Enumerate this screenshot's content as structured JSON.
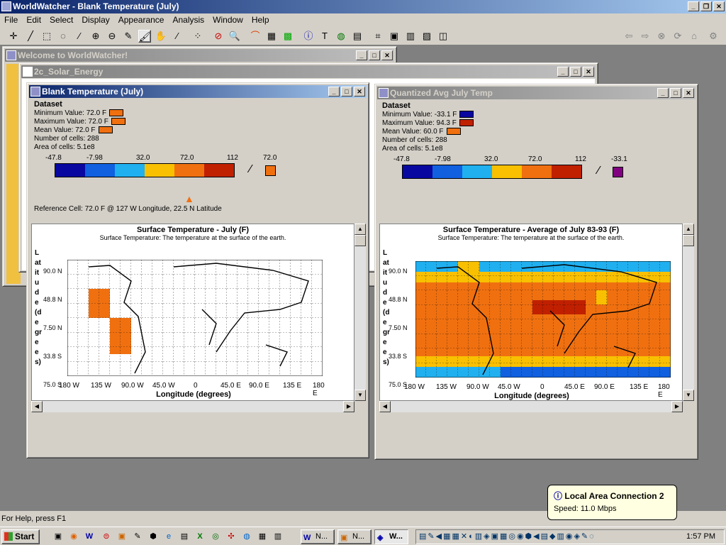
{
  "app": {
    "title": "WorldWatcher - Blank Temperature (July)"
  },
  "menu": [
    "File",
    "Edit",
    "Select",
    "Display",
    "Appearance",
    "Analysis",
    "Window",
    "Help"
  ],
  "icons": {
    "toolbar": [
      "crosshair-icon",
      "line-icon",
      "rect-select-icon",
      "lasso-icon",
      "wand-icon",
      "zoom-in-icon",
      "zoom-out-icon",
      "pencil-icon",
      "brush-icon",
      "hand-icon",
      "eyedropper-icon",
      "footprints-icon",
      "no-pan-icon",
      "magnifier-icon",
      "rainbow-icon",
      "grid-icon",
      "color-grid-icon",
      "info-icon",
      "text-icon",
      "globe-icon",
      "map-icon",
      "crop-icon",
      "image-icon",
      "histogram-icon",
      "graph-icon"
    ],
    "nav": [
      "back-icon",
      "forward-icon",
      "stop-icon",
      "refresh-icon",
      "home-icon",
      "gear-icon"
    ]
  },
  "windows": {
    "welcome": {
      "title": "Welcome to WorldWatcher!"
    },
    "solar": {
      "title": "2c_Solar_Energy"
    },
    "blank": {
      "title": "Blank Temperature (July)",
      "heading": "Dataset",
      "min": "Minimum Value: 72.0 F",
      "max": "Maximum Value: 72.0 F",
      "mean": "Mean Value: 72.0 F",
      "cells": "Number of cells: 288",
      "area": "Area of cells: 5.1e8",
      "ticks": [
        "-47.8",
        "-7.98",
        "32.0",
        "72.0",
        "112"
      ],
      "current": "72.0",
      "current_color": "#f07010",
      "ref": "Reference Cell: 72.0 F @ 127 W Longitude, 22.5 N Latitude",
      "plot_title": "Surface Temperature - July (F)",
      "plot_subtitle": "Surface Temperature: The temperature at the surface of the earth.",
      "ylabel": "Latitude (degrees)",
      "xlabel": "Longitude (degrees)",
      "yticks": [
        "90.0 N",
        "48.8 N",
        "7.50 N",
        "33.8 S",
        "75.0 S"
      ],
      "xticks": [
        "180 W",
        "135 W",
        "90.0 W",
        "45.0 W",
        "0",
        "45.0 E",
        "90.0 E",
        "135 E",
        "180 E"
      ]
    },
    "quant": {
      "title": "Quantized Avg July Temp",
      "heading": "Dataset",
      "min": "Minimum Value: -33.1 F",
      "max": "Maximum Value: 94.3 F",
      "mean": "Mean Value: 60.0 F",
      "cells": "Number of cells: 288",
      "area": "Area of cells: 5.1e8",
      "ticks": [
        "-47.8",
        "-7.98",
        "32.0",
        "72.0",
        "112"
      ],
      "current": "-33.1",
      "current_color": "#800080",
      "plot_title": "Surface Temperature - Average of July 83-93 (F)",
      "plot_subtitle": "Surface Temperature: The temperature at the surface of the earth.",
      "ylabel": "Latitude (degrees)",
      "xlabel": "Longitude (degrees)",
      "yticks": [
        "90.0 N",
        "48.8 N",
        "7.50 N",
        "33.8 S",
        "75.0 S"
      ],
      "xticks": [
        "180 W",
        "135 W",
        "90.0 W",
        "45.0 W",
        "0",
        "45.0 E",
        "90.0 E",
        "135 E",
        "180 E"
      ]
    }
  },
  "colors": {
    "scale": [
      "#0808a0",
      "#1060e0",
      "#20b0f0",
      "#f8c000",
      "#f07010",
      "#c02000"
    ],
    "min_blank": "#f07010",
    "max_blank": "#f07010",
    "mean_blank": "#f07010",
    "min_quant": "#0808a0",
    "max_quant": "#c02000",
    "mean_quant": "#f07010"
  },
  "status": "For Help, press F1",
  "taskbar": {
    "start": "Start",
    "tasks": [
      "N...",
      "N...",
      "W..."
    ],
    "clock": "1:57 PM"
  },
  "balloon": {
    "title": "Local Area Connection 2",
    "body": "Speed: 11.0 Mbps"
  }
}
